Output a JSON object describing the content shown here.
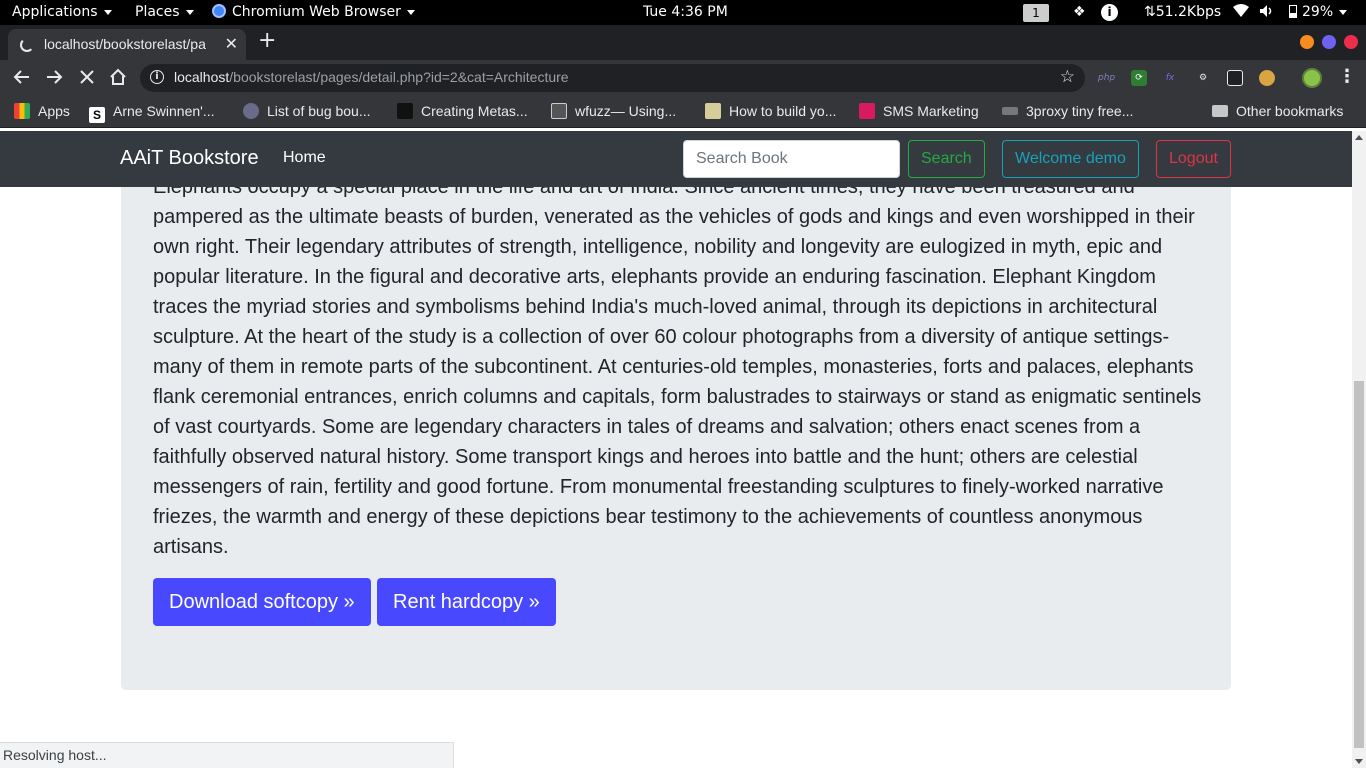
{
  "os_panel": {
    "applications": "Applications",
    "places": "Places",
    "browser_app": "Chromium Web Browser",
    "clock": "Tue  4:36 PM",
    "workspace": "1",
    "network_speed": "⇅51.2Kbps",
    "battery": "29%"
  },
  "browser": {
    "tab_title": "localhost/bookstorelast/pa",
    "url_host": "localhost",
    "url_path": "/bookstorelast/pages/detail.php?id=2&cat=Architecture",
    "bookmarks": [
      "Apps",
      "Arne Swinnen'...",
      "List of bug bou...",
      "Creating Metas...",
      "wfuzz— Using...",
      "How to build yo...",
      "SMS Marketing",
      "3proxy tiny free...",
      "Other bookmarks"
    ],
    "status_text": "Resolving host..."
  },
  "site": {
    "brand": "AAiT Bookstore",
    "nav_home": "Home",
    "search_placeholder": "Search Book",
    "search_button": "Search",
    "welcome": "Welcome demo",
    "logout": "Logout",
    "description": "Elephants occupy a special place in the life and art of India. Since ancient times, they have been treasured and pampered as the ultimate beasts of burden, venerated as the vehicles of gods and kings and even worshipped in their own right. Their legendary attributes of strength, intelligence, nobility and longevity are eulogized in myth, epic and popular literature. In the figural and decorative arts, elephants provide an enduring fascination. Elephant Kingdom traces the myriad stories and symbolisms behind India's much-loved animal, through its depictions in architectural sculpture. At the heart of the study is a collection of over 60 colour photographs from a diversity of antique settings-many of them in remote parts of the subcontinent. At centuries-old temples, monasteries, forts and palaces, elephants flank ceremonial entrances, enrich columns and capitals, form balustrades to stairways or stand as enigmatic sentinels of vast courtyards. Some are legendary characters in tales of dreams and salvation; others enact scenes from a faithfully observed natural history. Some transport kings and heroes into battle and the hunt; others are celestial messengers of rain, fertility and good fortune. From monumental freestanding sculptures to finely-worked narrative friezes, the warmth and energy of these depictions bear testimony to the achievements of countless anonymous artisans.",
    "download_button": "Download softcopy »",
    "rent_button": "Rent hardcopy »"
  },
  "colors": {
    "navbar_bg": "#343a40",
    "jumbotron_bg": "#e9ecef",
    "primary_button": "#4848ff",
    "search_green": "#28a745",
    "welcome_teal": "#17a2b8",
    "logout_red": "#dc3545"
  }
}
